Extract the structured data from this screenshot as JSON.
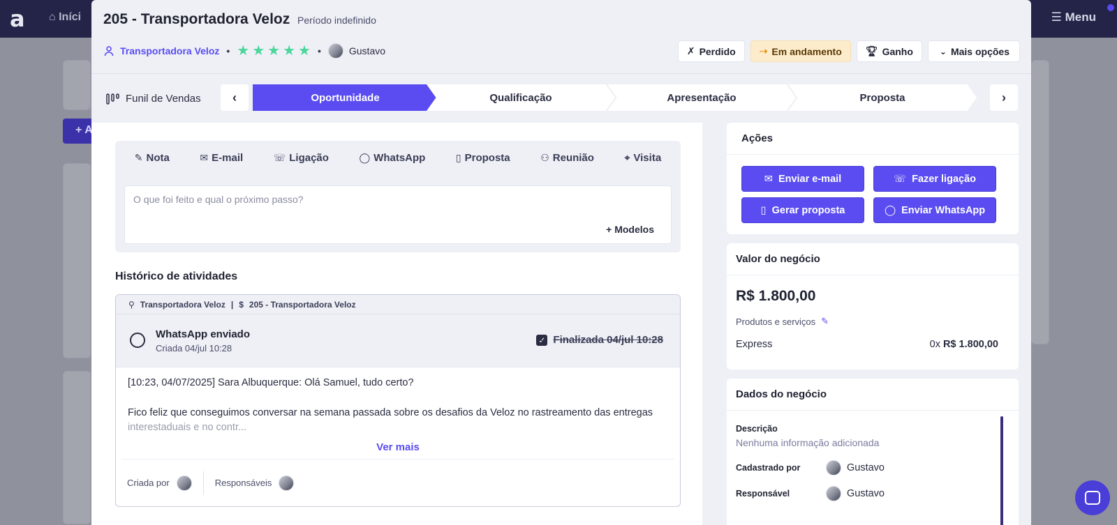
{
  "background": {
    "logo": "a",
    "home_label": "Iníci",
    "menu_label": "Menu",
    "add_button": "+ A"
  },
  "header": {
    "title": "205 - Transportadora Veloz",
    "period": "Período indefinido",
    "company": "Transportadora Veloz",
    "rating": 5,
    "owner": "Gustavo",
    "status_buttons": {
      "lost": "Perdido",
      "in_progress": "Em andamento",
      "won": "Ganho",
      "more": "Mais opções"
    }
  },
  "funnel": {
    "label": "Funil de Vendas",
    "stages": [
      "Oportunidade",
      "Qualificação",
      "Apresentação",
      "Proposta"
    ],
    "active_stage": "Oportunidade"
  },
  "composer": {
    "tabs": [
      "Nota",
      "E-mail",
      "Ligação",
      "WhatsApp",
      "Proposta",
      "Reunião",
      "Visita"
    ],
    "placeholder": "O que foi feito e qual o próximo passo?",
    "templates": "+ Modelos"
  },
  "history": {
    "title": "Histórico de atividades",
    "activity": {
      "contact": "Transportadora Veloz",
      "deal": "205 - Transportadora Veloz",
      "type": "WhatsApp enviado",
      "created": "Criada 04/jul 10:28",
      "finished": "Finalizada 04/jul 10:28",
      "line1": "[10:23, 04/07/2025] Sara Albuquerque: Olá Samuel, tudo certo?",
      "line2": "Fico feliz que conseguimos conversar na semana passada sobre os desafios da Veloz no rastreamento das entregas",
      "line3": "interestaduais e no contr...",
      "see_more": "Ver mais",
      "created_by": "Criada por",
      "responsibles": "Responsáveis"
    }
  },
  "actions": {
    "title": "Ações",
    "send_email": "Enviar e-mail",
    "make_call": "Fazer ligação",
    "generate_proposal": "Gerar proposta",
    "send_whatsapp": "Enviar WhatsApp"
  },
  "deal_value": {
    "title": "Valor do negócio",
    "amount": "R$ 1.800,00",
    "products_label": "Produtos e serviços",
    "product_name": "Express",
    "product_qty": "0x",
    "product_amount": "R$ 1.800,00"
  },
  "deal_data": {
    "title": "Dados do negócio",
    "description_label": "Descrição",
    "description_value": "Nenhuma informação adicionada",
    "registered_by_label": "Cadastrado por",
    "registered_by": "Gustavo",
    "responsible_label": "Responsável",
    "responsible": "Gustavo"
  },
  "colors": {
    "accent": "#5a4cf0",
    "star": "#4bd69b",
    "in_progress_bg": "#fdeccb",
    "topbar": "#232447"
  }
}
